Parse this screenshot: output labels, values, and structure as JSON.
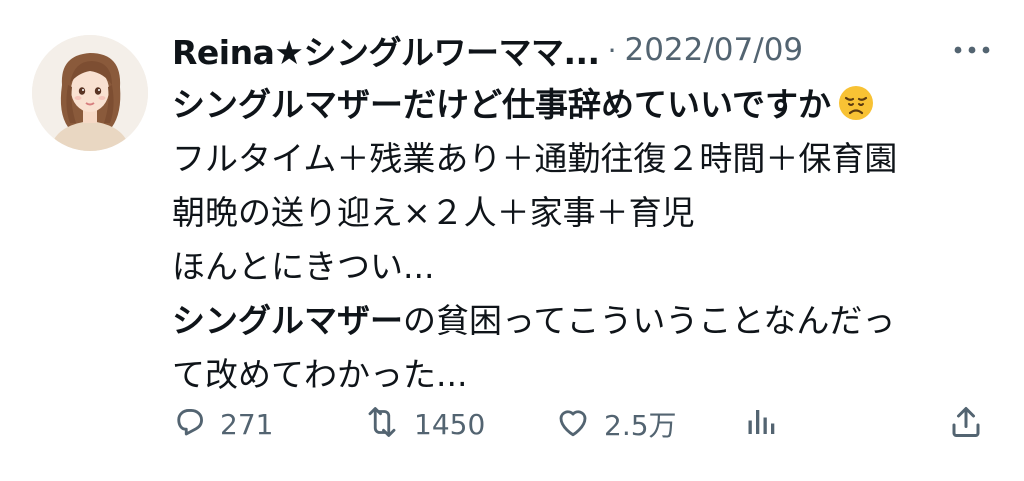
{
  "tweet": {
    "display_name": "Reina★シングルワーママ...",
    "separator": "·",
    "date": "2022/07/09",
    "avatar": {
      "icon": "avatar-illustration"
    },
    "more_icon": "more-icon",
    "body": {
      "line1_bold": "シングルマザーだけど仕事辞めていいですか",
      "line1_emoji": "disappointed-face-emoji",
      "line2": "フルタイム＋残業あり＋通勤往復２時間＋保育園",
      "line3": "朝晩の送り迎え×２人＋家事＋育児",
      "line4": "ほんとにきつい...",
      "line5_bold": "シングルマザー",
      "line5_rest": "の貧困ってこういうことなんだっ",
      "line6": "て改めてわかった..."
    },
    "actions": {
      "reply": {
        "icon": "reply-icon",
        "count": "271"
      },
      "retweet": {
        "icon": "retweet-icon",
        "count": "1450"
      },
      "like": {
        "icon": "heart-icon",
        "count": "2.5万"
      },
      "views": {
        "icon": "views-icon"
      },
      "share": {
        "icon": "share-icon"
      }
    }
  },
  "colors": {
    "text": "#0f1419",
    "secondary": "#536471",
    "background": "#ffffff"
  }
}
